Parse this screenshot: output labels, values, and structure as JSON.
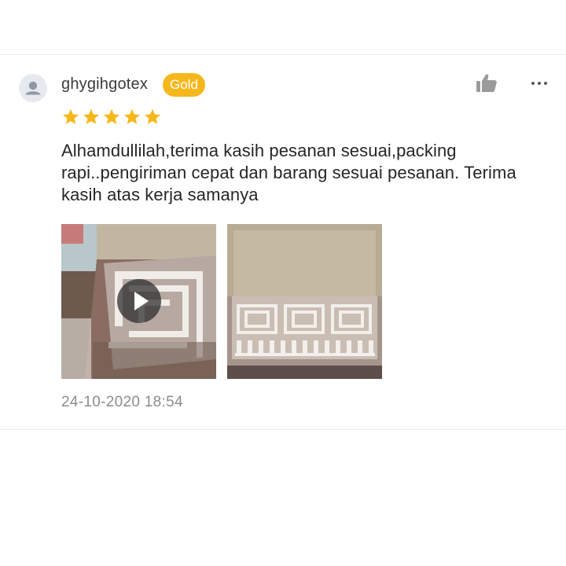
{
  "review": {
    "username": "ghygihgotex",
    "badge": "Gold",
    "rating": 5,
    "max_rating": 5,
    "text": "Alhamdullilah,terima kasih pesanan sesuai,packing rapi..pengiriman cepat dan barang sesuai pesanan. Terima kasih atas kerja samanya",
    "timestamp": "24-10-2020 18:54"
  },
  "actions": {
    "like_icon": "thumbs-up-icon",
    "more_icon": "more-dots-icon"
  },
  "media": [
    {
      "type": "video",
      "icon": "play-icon"
    },
    {
      "type": "photo"
    }
  ],
  "colors": {
    "badge": "#f5b81c",
    "star": "#f5b81c",
    "text": "#262626",
    "muted": "#8c8c8c",
    "divider": "#ececec",
    "icon": "#9a9a9a"
  }
}
